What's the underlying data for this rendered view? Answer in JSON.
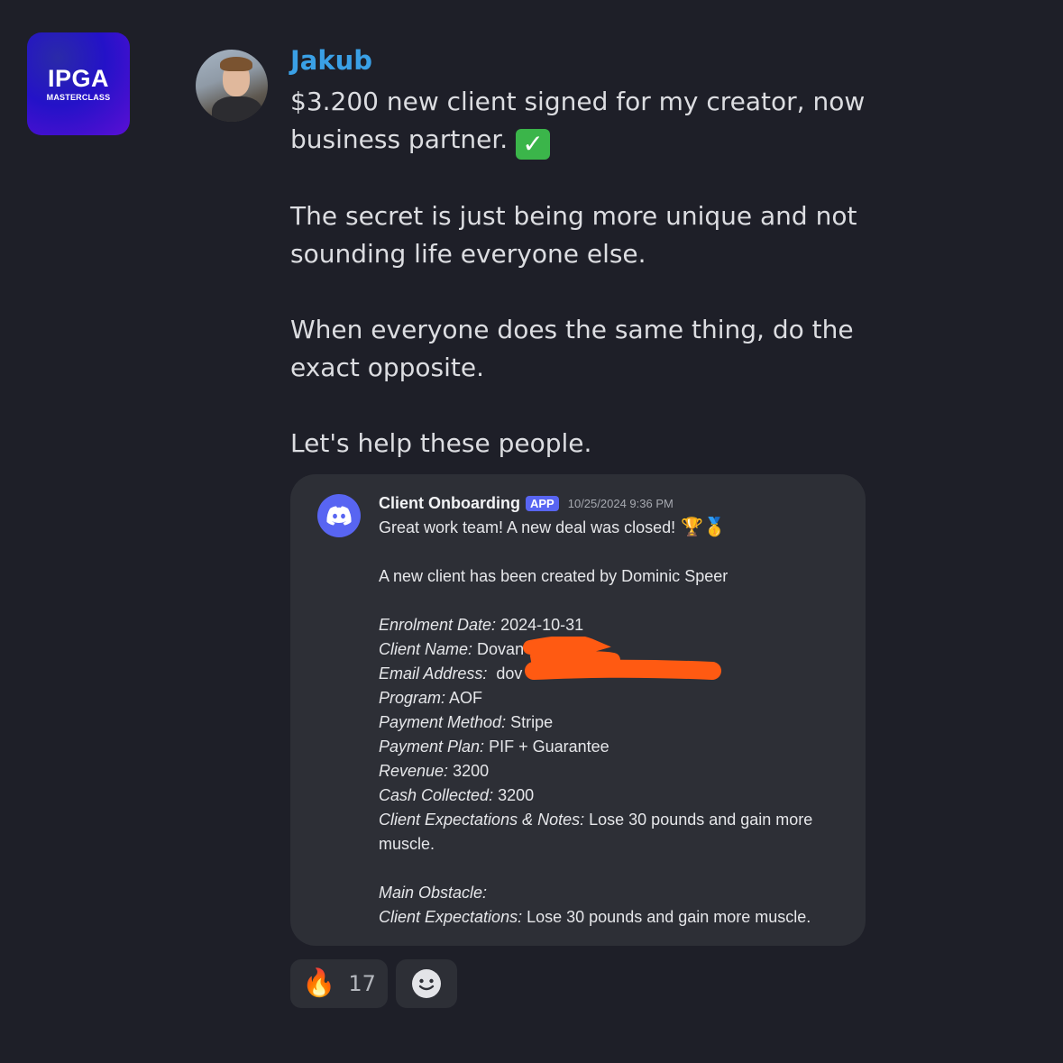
{
  "logo": {
    "title": "IPGA",
    "subtitle": "MASTERCLASS"
  },
  "message": {
    "author": "Jakub",
    "paragraphs": [
      "$3.200 new client signed for my creator, now business partner.",
      "The secret is just being more unique and not sounding life everyone else.",
      "When everyone does the same thing, do the exact opposite.",
      "Let's help these people."
    ]
  },
  "embed": {
    "bot_name": "Client Onboarding",
    "badge": "APP",
    "timestamp": "10/25/2024 9:36 PM",
    "headline": "Great work team! A new deal was closed!",
    "intro": "A new client has been created by Dominic Speer",
    "fields": [
      {
        "label": "Enrolment Date:",
        "value": " 2024-10-31"
      },
      {
        "label": "Client Name:",
        "value": " Dovan S"
      },
      {
        "label": "Email Address:",
        "value": "  dov"
      },
      {
        "label": "Program:",
        "value": " AOF"
      },
      {
        "label": "Payment Method:",
        "value": " Stripe"
      },
      {
        "label": "Payment Plan:",
        "value": " PIF + Guarantee"
      },
      {
        "label": "Revenue:",
        "value": " 3200"
      },
      {
        "label": "Cash Collected:",
        "value": " 3200"
      },
      {
        "label": "Client Expectations & Notes:",
        "value": " Lose 30 pounds and gain more muscle."
      }
    ],
    "footer_fields": [
      {
        "label": "Main Obstacle:",
        "value": ""
      },
      {
        "label": "Client Expectations:",
        "value": " Lose 30 pounds and gain more muscle."
      }
    ]
  },
  "reactions": [
    {
      "icon": "fire-emoji",
      "count": "17"
    },
    {
      "icon": "add-reaction-icon"
    }
  ],
  "colors": {
    "background": "#1e1f28",
    "username": "#3aa0e6",
    "embed": "#2d2f36",
    "blurple": "#5865f2",
    "redaction": "#ff5a12"
  }
}
